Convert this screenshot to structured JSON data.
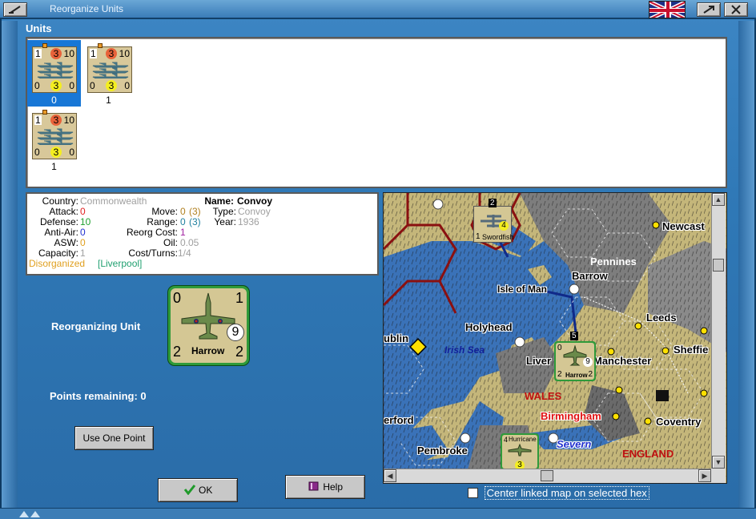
{
  "window": {
    "title": "Reorganize Units"
  },
  "units_section": {
    "title": "Units"
  },
  "units": [
    {
      "top_left": "1",
      "top_mid": "3",
      "top_right": "10",
      "bot_left": "0",
      "bot_mid": "3",
      "bot_right": "0",
      "caption": "0",
      "selected": true
    },
    {
      "top_left": "1",
      "top_mid": "3",
      "top_right": "10",
      "bot_left": "0",
      "bot_mid": "3",
      "bot_right": "0",
      "caption": "1",
      "selected": false
    },
    {
      "top_left": "1",
      "top_mid": "3",
      "top_right": "10",
      "bot_left": "0",
      "bot_mid": "3",
      "bot_right": "0",
      "caption": "1",
      "selected": false
    }
  ],
  "info": {
    "country_label": "Country:",
    "country": "Commonwealth",
    "attack_label": "Attack:",
    "attack": "0",
    "defense_label": "Defense:",
    "defense": "10",
    "antiair_label": "Anti-Air:",
    "antiair": "0",
    "asw_label": "ASW:",
    "asw": "0",
    "capacity_label": "Capacity:",
    "capacity": "1",
    "status": "Disorganized",
    "location": "[Liverpool]",
    "name_label": "Name:",
    "name": "Convoy",
    "move_label": "Move:",
    "move": "0",
    "move_extra": "(3)",
    "type_label": "Type:",
    "type": "Convoy",
    "range_label": "Range:",
    "range": "0",
    "range_extra": "(3)",
    "year_label": "Year:",
    "year": "1936",
    "reorg_label": "Reorg Cost:",
    "reorg": "1",
    "oil_label": "Oil:",
    "oil": "0.05",
    "cost_label": "Cost/Turns:",
    "cost": "1/4"
  },
  "reorganizing": {
    "label": "Reorganizing Unit",
    "unit": {
      "tl": "0",
      "tr": "1",
      "bl": "2",
      "br": "2",
      "badge": "9",
      "name": "Harrow"
    }
  },
  "points": {
    "label": "Points remaining:",
    "value": "0"
  },
  "buttons": {
    "use_one_point": "Use One Point",
    "ok": "OK",
    "help": "Help"
  },
  "map": {
    "labels": {
      "newcastle": "Newcast",
      "pennines": "Pennines",
      "barrow": "Barrow",
      "isle_of_man": "Isle of Man",
      "leeds": "Leeds",
      "holyhead": "Holyhead",
      "irish_sea": "Irish Sea",
      "dublin": "ublin",
      "liverpool": "Liver",
      "manchester": "Manchester",
      "sheffield": "Sheffie",
      "wales": "WALES",
      "birmingham": "Birmingham",
      "coventry": "Coventry",
      "wexford": "erford",
      "pembroke": "Pembroke",
      "severn": "Severn",
      "england": "ENGLAND"
    },
    "units": {
      "swordfish": {
        "name": "Swordfish",
        "value": "4",
        "bl": "1",
        "stack": "2"
      },
      "harrow": {
        "name": "Harrow",
        "tl": "0",
        "badge": "9",
        "bl": "2",
        "br": "2",
        "stack": "5"
      },
      "hurricane": {
        "name": "Hurricane",
        "value": "3",
        "top": "4"
      }
    }
  },
  "center_linked": {
    "label": "Center linked map on selected hex",
    "checked": false
  }
}
